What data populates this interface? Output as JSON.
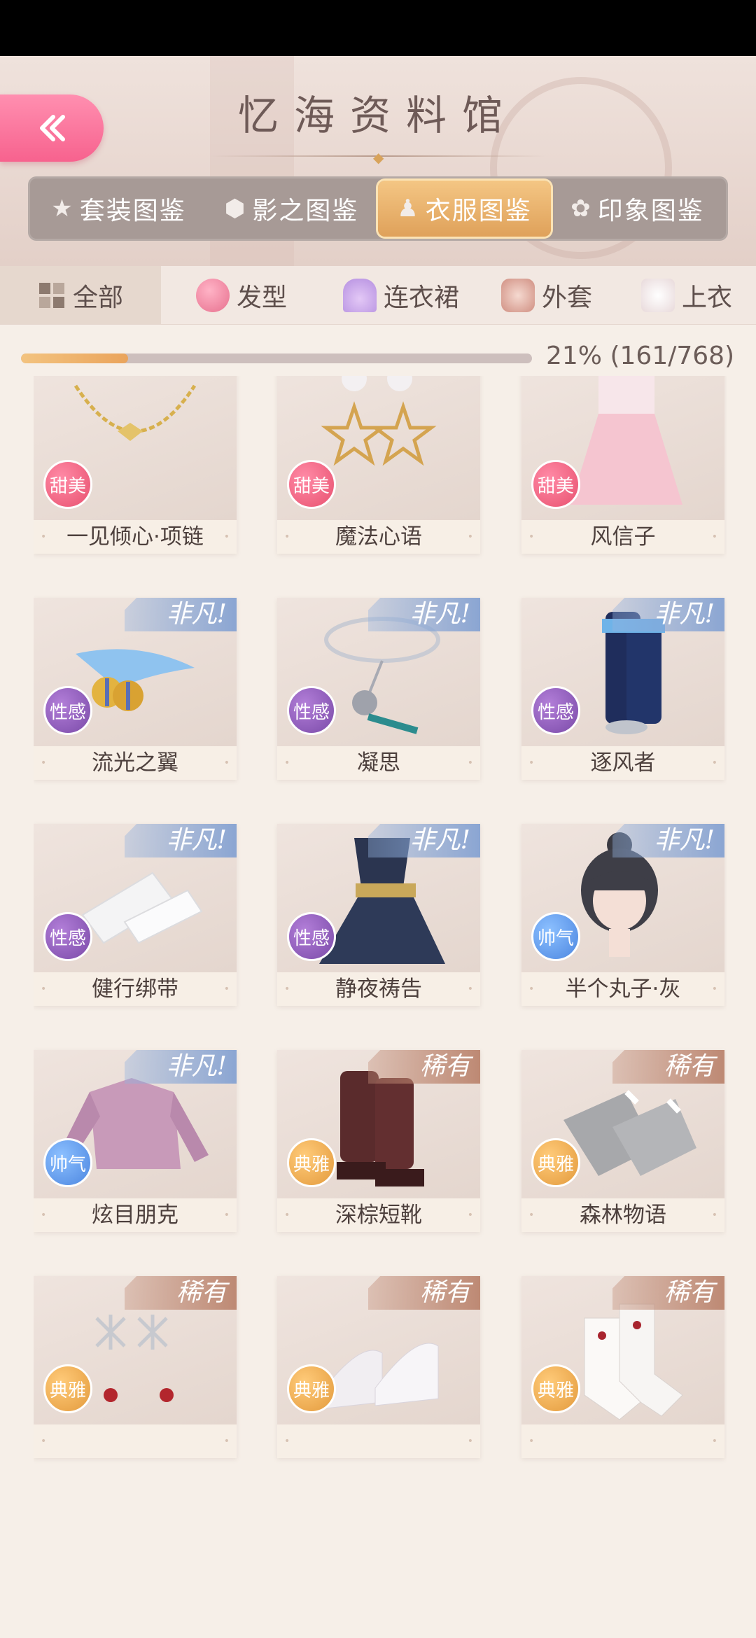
{
  "header": {
    "title": "忆海资料馆",
    "tabs": [
      {
        "label": "套装图鉴",
        "icon": "star-icon",
        "active": false
      },
      {
        "label": "影之图鉴",
        "icon": "hexagon-icon",
        "active": false
      },
      {
        "label": "衣服图鉴",
        "icon": "dress-icon",
        "active": true
      },
      {
        "label": "印象图鉴",
        "icon": "flower-icon",
        "active": false
      }
    ]
  },
  "categories": [
    {
      "label": "全部",
      "icon": "grid-icon",
      "active": true
    },
    {
      "label": "发型",
      "icon": "hair-icon",
      "active": false
    },
    {
      "label": "连衣裙",
      "icon": "dress-icon",
      "active": false
    },
    {
      "label": "外套",
      "icon": "coat-icon",
      "active": false
    },
    {
      "label": "上衣",
      "icon": "shirt-icon",
      "active": false
    }
  ],
  "progress": {
    "text": "21% (161/768)",
    "fraction": 0.21
  },
  "colors": {
    "accent": "#eaa45c",
    "back_button": "#f7628e",
    "sweet": "#e8516f",
    "sexy": "#7a4aa8",
    "cool": "#4c86e0",
    "elegant": "#e39a3c"
  },
  "items": [
    {
      "name": "一见倾心·项链",
      "tag": "甜美",
      "style": "sweet",
      "rarity": "",
      "icon": "necklace-icon"
    },
    {
      "name": "魔法心语",
      "tag": "甜美",
      "style": "sweet",
      "rarity": "",
      "icon": "star-earrings-icon"
    },
    {
      "name": "风信子",
      "tag": "甜美",
      "style": "sweet",
      "rarity": "",
      "icon": "pink-dress-icon"
    },
    {
      "name": "流光之翼",
      "tag": "性感",
      "style": "sexy",
      "rarity": "非凡!",
      "icon": "wing-earrings-icon"
    },
    {
      "name": "凝思",
      "tag": "性感",
      "style": "sexy",
      "rarity": "非凡!",
      "icon": "choker-icon"
    },
    {
      "name": "逐风者",
      "tag": "性感",
      "style": "sexy",
      "rarity": "非凡!",
      "icon": "boots-icon"
    },
    {
      "name": "健行绑带",
      "tag": "性感",
      "style": "sexy",
      "rarity": "非凡!",
      "icon": "bandage-icon"
    },
    {
      "name": "静夜祷告",
      "tag": "性感",
      "style": "sexy",
      "rarity": "非凡!",
      "icon": "navy-dress-icon"
    },
    {
      "name": "半个丸子·灰",
      "tag": "帅气",
      "style": "cool",
      "rarity": "非凡!",
      "icon": "hairstyle-icon"
    },
    {
      "name": "炫目朋克",
      "tag": "帅气",
      "style": "cool",
      "rarity": "非凡!",
      "icon": "sequin-top-icon"
    },
    {
      "name": "深棕短靴",
      "tag": "典雅",
      "style": "elegant",
      "rarity": "稀有",
      "icon": "brown-boots-icon"
    },
    {
      "name": "森林物语",
      "tag": "典雅",
      "style": "elegant",
      "rarity": "稀有",
      "icon": "socks-icon"
    },
    {
      "name": "",
      "tag": "典雅",
      "style": "elegant",
      "rarity": "稀有",
      "icon": "snowflake-earrings-icon"
    },
    {
      "name": "",
      "tag": "典雅",
      "style": "elegant",
      "rarity": "稀有",
      "icon": "white-shoes-icon"
    },
    {
      "name": "",
      "tag": "典雅",
      "style": "elegant",
      "rarity": "稀有",
      "icon": "lace-socks-icon"
    }
  ]
}
